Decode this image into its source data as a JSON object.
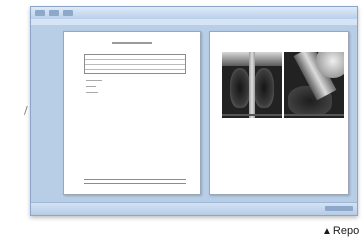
{
  "margin_glyph": "/",
  "window": {
    "left_page": {
      "form_rows": 4,
      "body_lines": [
        "l1",
        "l2",
        "l3"
      ]
    },
    "right_page": {
      "images": [
        {
          "name": "frontal-chest-xray"
        },
        {
          "name": "lateral-chest-xray"
        }
      ]
    }
  },
  "caption": {
    "icon": "triangle-up-icon",
    "glyph": "▲",
    "text": "Repo"
  }
}
